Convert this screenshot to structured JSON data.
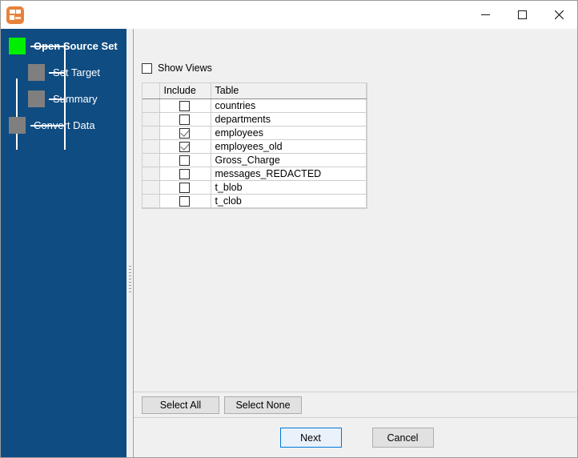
{
  "window": {
    "title": "",
    "icon": "app-icon",
    "controls": {
      "minimize": "minimize-icon",
      "maximize": "maximize-icon",
      "close": "close-icon"
    }
  },
  "sidebar": {
    "background_color": "#0f4c81",
    "active_color": "#00ef00",
    "idle_color": "#7f7f7f",
    "steps": [
      {
        "label": "Open Source Set",
        "state": "active",
        "bold": true
      },
      {
        "label": "Set Target",
        "state": "idle",
        "bold": false
      },
      {
        "label": "Summary",
        "state": "idle",
        "bold": false
      },
      {
        "label": "Convert Data",
        "state": "idle",
        "bold": false
      }
    ]
  },
  "main": {
    "show_views": {
      "label": "Show Views",
      "checked": false
    },
    "grid": {
      "headers": [
        "",
        "Include",
        "Table"
      ],
      "rows": [
        {
          "include": false,
          "table": "countries"
        },
        {
          "include": false,
          "table": "departments"
        },
        {
          "include": true,
          "table": "employees"
        },
        {
          "include": true,
          "table": "employees_old"
        },
        {
          "include": false,
          "table": "Gross_Charge"
        },
        {
          "include": false,
          "table": "messages_REDACTED"
        },
        {
          "include": false,
          "table": "t_blob"
        },
        {
          "include": false,
          "table": "t_clob"
        }
      ]
    },
    "select_bar": {
      "select_all": "Select All",
      "select_none": "Select None"
    }
  },
  "footer": {
    "next": "Next",
    "cancel": "Cancel",
    "primary_color": "#0078d7"
  }
}
